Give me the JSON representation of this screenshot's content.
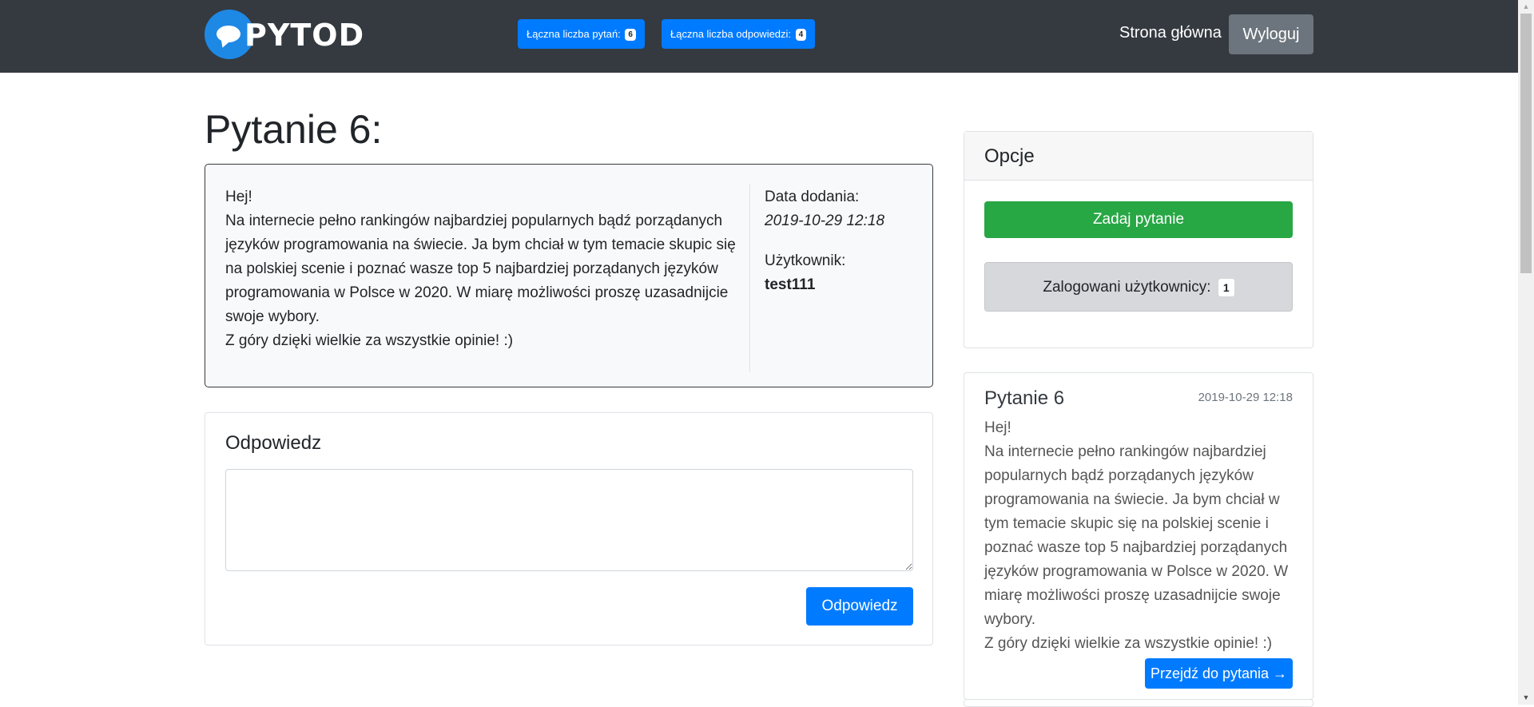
{
  "app": {
    "logo_text": "PYTOD"
  },
  "header": {
    "total_questions_label": "Łączna liczba pytań:",
    "total_questions_count": "6",
    "total_answers_label": "Łączna liczba odpowiedzi:",
    "total_answers_count": "4",
    "home_link": "Strona główna",
    "logout_button": "Wyloguj"
  },
  "question": {
    "title": "Pytanie 6:",
    "body": "Hej!\nNa internecie pełno rankingów najbardziej popularnych bądź porządanych języków programowania na świecie. Ja bym chciał w tym temacie skupic się na polskiej scenie i poznać wasze top 5 najbardziej porządanych języków programowania w Polsce w 2020. W miarę możliwości proszę uzasadnijcie swoje wybory.\nZ góry dzięki wielkie za wszystkie opinie! :)",
    "date_label": "Data dodania:",
    "date_value": "2019-10-29 12:18",
    "user_label": "Użytkownik:",
    "user_value": "test111"
  },
  "answer_form": {
    "title": "Odpowiedz",
    "textarea_value": "",
    "submit_button": "Odpowiedz"
  },
  "options": {
    "header": "Opcje",
    "ask_button": "Zadaj pytanie",
    "logged_users_label": "Zalogowani użytkownicy:",
    "logged_users_count": "1"
  },
  "preview": {
    "title": "Pytanie 6",
    "date": "2019-10-29 12:18",
    "body": "Hej!\nNa internecie pełno rankingów najbardziej popularnych bądź porządanych języków programowania na świecie. Ja bym chciał w tym temacie skupic się na polskiej scenie i poznać wasze top 5 najbardziej porządanych języków programowania w Polsce w 2020. W miarę możliwości proszę uzasadnijcie swoje wybory.\nZ góry dzięki wielkie za wszystkie opinie! :)",
    "goto_button": "Przejdź do pytania →"
  },
  "colors": {
    "navbar": "#343a40",
    "primary": "#007bff",
    "success": "#28a745",
    "secondary": "#6c757d"
  }
}
